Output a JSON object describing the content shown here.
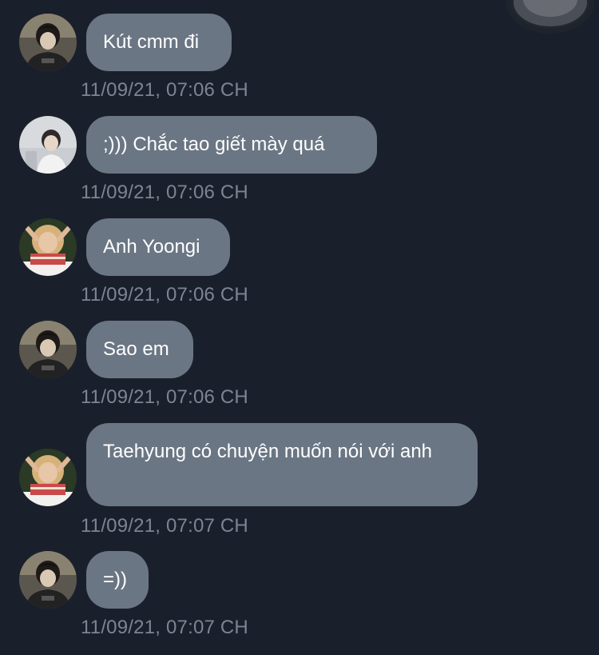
{
  "messages": [
    {
      "text": "Kút cmm đi",
      "time": "11/09/21, 07:06 CH",
      "avatar": "avatar-dark-hair-boy"
    },
    {
      "text": ";))) Chắc tao giết mày quá",
      "time": "11/09/21, 07:06 CH",
      "avatar": "avatar-light-boy"
    },
    {
      "text": "Anh Yoongi",
      "time": "11/09/21, 07:06 CH",
      "avatar": "avatar-blonde-girl"
    },
    {
      "text": "Sao em",
      "time": "11/09/21, 07:06 CH",
      "avatar": "avatar-dark-hair-boy"
    },
    {
      "text": "Taehyung có chuyện muốn nói với anh",
      "time": "11/09/21, 07:07 CH",
      "avatar": "avatar-blonde-girl"
    },
    {
      "text": "=))",
      "time": "11/09/21, 07:07 CH",
      "avatar": "avatar-dark-hair-boy"
    }
  ],
  "colors": {
    "background": "#1a202b",
    "bubble": "#6b7684",
    "timestamp": "#7b8593",
    "text": "#ffffff"
  },
  "icons": {
    "corner_control": "scroll-button-icon"
  }
}
